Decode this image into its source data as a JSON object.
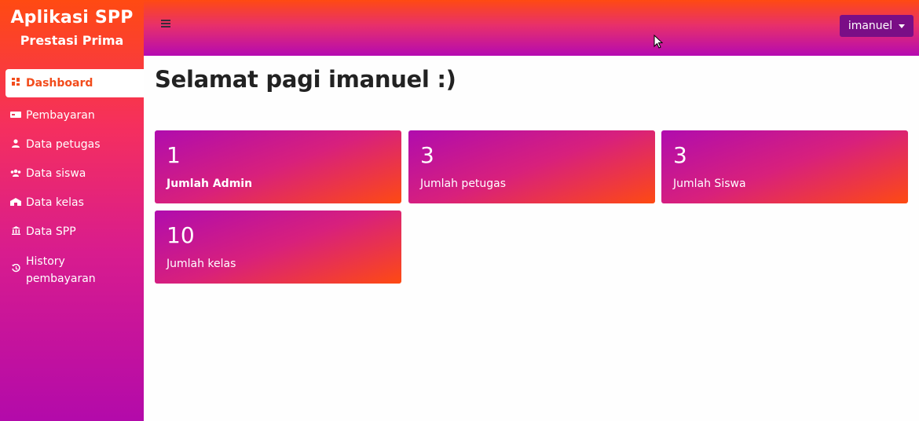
{
  "brand": {
    "title": "Aplikasi SPP",
    "subtitle": "Prestasi Prima"
  },
  "sidebar": {
    "items": [
      {
        "label": "Dashboard",
        "icon": "dashboard-icon",
        "active": true
      },
      {
        "label": "Pembayaran",
        "icon": "payment-card-icon"
      },
      {
        "label": "Data petugas",
        "icon": "user-icon"
      },
      {
        "label": "Data siswa",
        "icon": "users-icon"
      },
      {
        "label": "Data kelas",
        "icon": "school-icon"
      },
      {
        "label": "Data SPP",
        "icon": "bank-icon"
      },
      {
        "label_line1": "History",
        "label_line2": "pembayaran",
        "icon": "history-icon"
      }
    ]
  },
  "topbar": {
    "user": "imanuel"
  },
  "main": {
    "greeting": "Selamat pagi imanuel :)",
    "cards": [
      {
        "value": "1",
        "label": "Jumlah Admin"
      },
      {
        "value": "3",
        "label": "Jumlah petugas"
      },
      {
        "value": "3",
        "label": "Jumlah Siswa"
      },
      {
        "value": "10",
        "label": "Jumlah kelas"
      }
    ]
  },
  "colors": {
    "accent_orange": "#ff4a12",
    "accent_purple": "#b30aaa",
    "user_button": "#7a0e86"
  }
}
